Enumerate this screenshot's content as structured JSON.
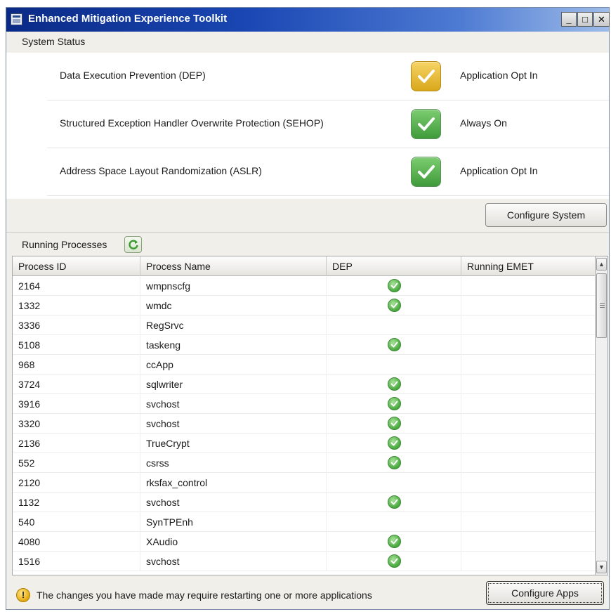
{
  "window": {
    "title": "Enhanced Mitigation Experience Toolkit"
  },
  "system_status": {
    "header": "System Status",
    "items": [
      {
        "label": "Data Execution Prevention (DEP)",
        "status_icon": "check-yellow-icon",
        "status_color": "#d9a71a",
        "value": "Application Opt In"
      },
      {
        "label": "Structured Exception Handler Overwrite Protection (SEHOP)",
        "status_icon": "check-green-icon",
        "status_color": "#3f9a3a",
        "value": "Always On"
      },
      {
        "label": "Address Space Layout Randomization (ASLR)",
        "status_icon": "check-green-icon",
        "status_color": "#3f9a3a",
        "value": "Application Opt In"
      }
    ],
    "configure_button": "Configure System"
  },
  "running_processes": {
    "header": "Running Processes",
    "columns": [
      "Process ID",
      "Process Name",
      "DEP",
      "Running EMET"
    ],
    "rows": [
      {
        "pid": "2164",
        "name": "wmpnscfg",
        "dep": true
      },
      {
        "pid": "1332",
        "name": "wmdc",
        "dep": true
      },
      {
        "pid": "3336",
        "name": "RegSrvc",
        "dep": false
      },
      {
        "pid": "5108",
        "name": "taskeng",
        "dep": true
      },
      {
        "pid": "968",
        "name": "ccApp",
        "dep": false
      },
      {
        "pid": "3724",
        "name": "sqlwriter",
        "dep": true
      },
      {
        "pid": "3916",
        "name": "svchost",
        "dep": true
      },
      {
        "pid": "3320",
        "name": "svchost",
        "dep": true
      },
      {
        "pid": "2136",
        "name": "TrueCrypt",
        "dep": true
      },
      {
        "pid": "552",
        "name": "csrss",
        "dep": true
      },
      {
        "pid": "2120",
        "name": "rksfax_control",
        "dep": false
      },
      {
        "pid": "1132",
        "name": "svchost",
        "dep": true
      },
      {
        "pid": "540",
        "name": "SynTPEnh",
        "dep": false
      },
      {
        "pid": "4080",
        "name": "XAudio",
        "dep": true
      },
      {
        "pid": "1516",
        "name": "svchost",
        "dep": true
      }
    ]
  },
  "footer": {
    "message": "The changes you have made may require restarting one or more applications",
    "configure_apps_button": "Configure Apps"
  }
}
